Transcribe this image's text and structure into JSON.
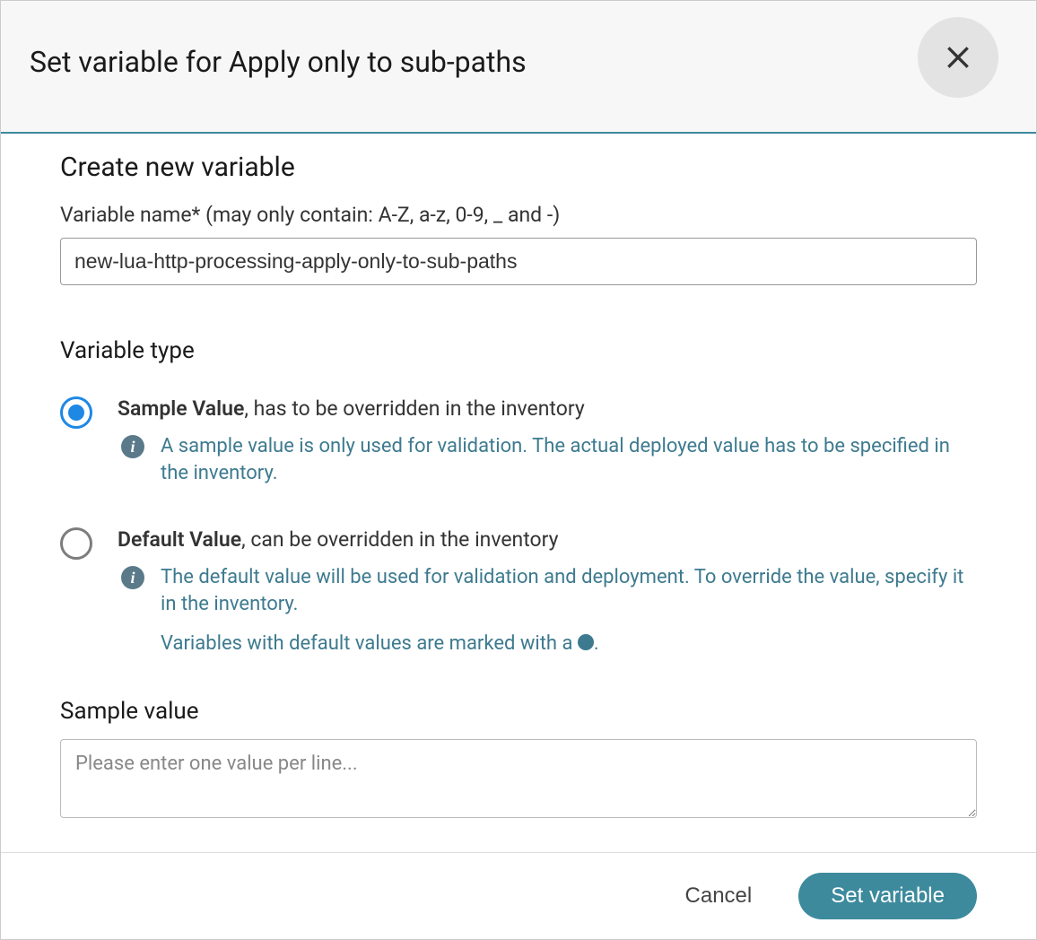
{
  "modal": {
    "title": "Set variable for Apply only to sub-paths"
  },
  "form": {
    "section_heading": "Create new variable",
    "name": {
      "label": "Variable name* (may only contain: A-Z, a-z, 0-9, _ and -)",
      "value": "new-lua-http-processing-apply-only-to-sub-paths"
    },
    "type": {
      "heading": "Variable type",
      "selected": "sample",
      "options": {
        "sample": {
          "title": "Sample Value",
          "suffix": ", has to be overridden in the inventory",
          "info": "A sample value is only used for validation. The actual deployed value has to be specified in the inventory."
        },
        "default": {
          "title": "Default Value",
          "suffix": ", can be overridden in the inventory",
          "info": "The default value will be used for validation and deployment. To override the value, specify it in the inventory.",
          "info2_prefix": "Variables with default values are marked with a ",
          "info2_suffix": "."
        }
      }
    },
    "sample_value": {
      "label": "Sample value",
      "placeholder": "Please enter one value per line...",
      "value": ""
    }
  },
  "footer": {
    "cancel": "Cancel",
    "submit": "Set variable"
  }
}
